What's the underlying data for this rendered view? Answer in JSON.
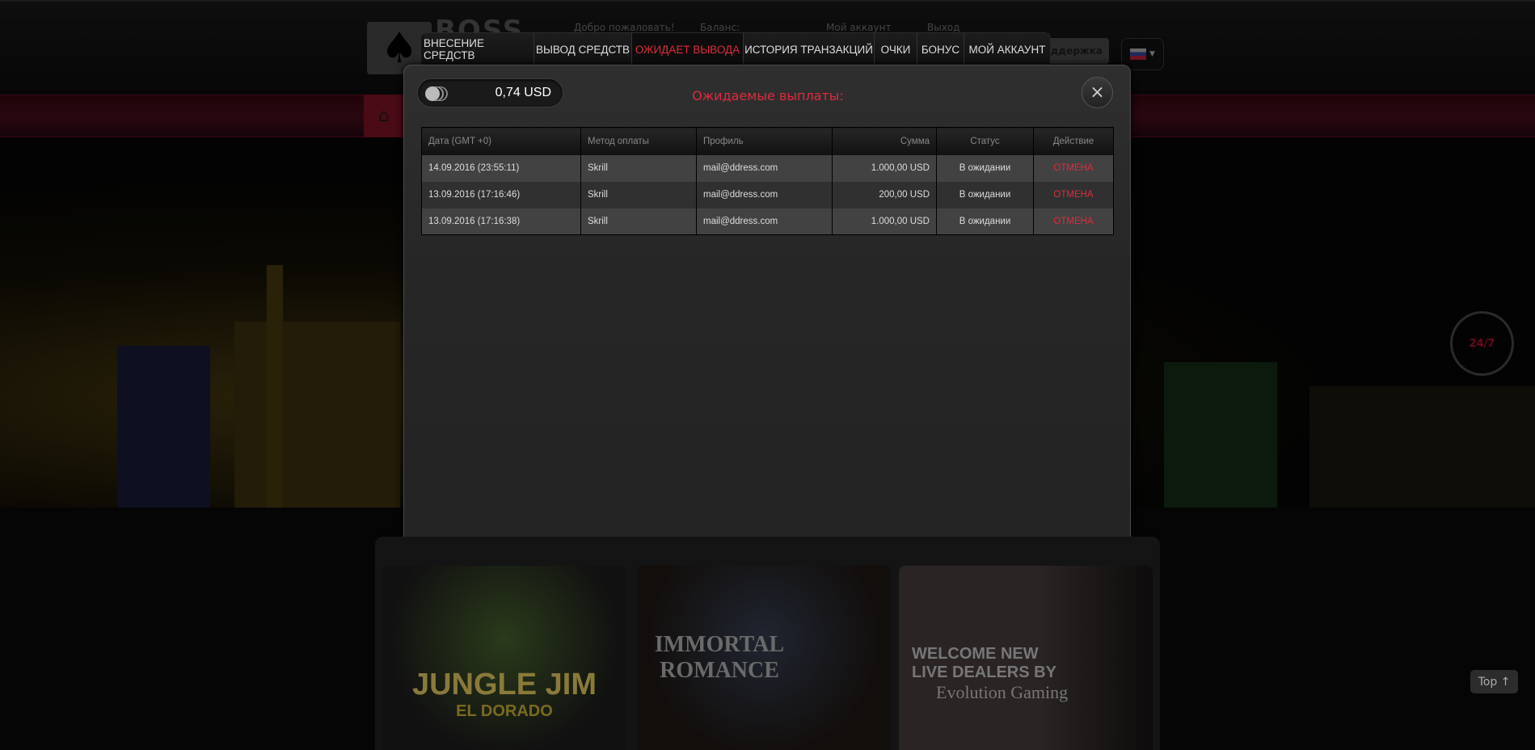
{
  "header": {
    "logo_text": "BOSS",
    "welcome": "Добро пожаловать!",
    "balance_label": "Баланс:",
    "account_link": "Мой аккаунт",
    "logout_link": "Выход",
    "support_label": "Поддержка"
  },
  "tabs": [
    {
      "label": "ВНЕСЕНИЕ СРЕДСТВ",
      "active": false
    },
    {
      "label": "ВЫВОД СРЕДСТВ",
      "active": false
    },
    {
      "label": "ОЖИДАЕТ ВЫВОДА",
      "active": true
    },
    {
      "label": "ИСТОРИЯ ТРАНЗАКЦИЙ",
      "active": false
    },
    {
      "label": "ОЧКИ",
      "active": false
    },
    {
      "label": "БОНУС",
      "active": false
    },
    {
      "label": "МОЙ АККАУНТ",
      "active": false
    }
  ],
  "modal": {
    "balance": "0,74 USD",
    "title": "Ожидаемые выплаты:",
    "columns": [
      "Дата (GMT +0)",
      "Метод оплаты",
      "Профиль",
      "Сумма",
      "Статус",
      "Действие"
    ],
    "rows": [
      {
        "date": "14.09.2016 (23:55:11)",
        "method": "Skrill",
        "profile": "mail@ddress.com",
        "amount": "1.000,00 USD",
        "status": "В ожидании",
        "action": "ОТМЕНА"
      },
      {
        "date": "13.09.2016 (17:16:46)",
        "method": "Skrill",
        "profile": "mail@ddress.com",
        "amount": "200,00 USD",
        "status": "В ожидании",
        "action": "ОТМЕНА"
      },
      {
        "date": "13.09.2016 (17:16:38)",
        "method": "Skrill",
        "profile": "mail@ddress.com",
        "amount": "1.000,00 USD",
        "status": "В ожидании",
        "action": "ОТМЕНА"
      }
    ]
  },
  "games": [
    {
      "title": "JUNGLE JIM",
      "subtitle": "EL DORADO"
    },
    {
      "title": "IMMORTAL",
      "subtitle": "ROMANCE"
    },
    {
      "title": "WELCOME NEW LIVE DEALERS BY",
      "subtitle": "Evolution Gaming"
    }
  ],
  "chat_label": "24/7",
  "top_button": "Top ↑",
  "colors": {
    "accent": "#e02a3c",
    "modal_bg": "#2a2a2a"
  }
}
